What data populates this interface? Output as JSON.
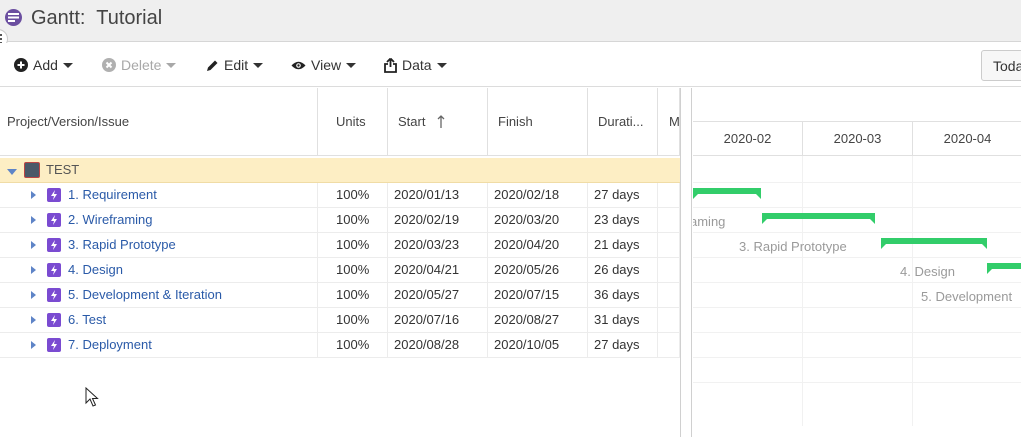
{
  "window": {
    "title": "Gantt:  Tutorial",
    "app_icon": "app-menu-icon"
  },
  "toolbar": {
    "add_label": "Add",
    "delete_label": "Delete",
    "edit_label": "Edit",
    "view_label": "View",
    "data_label": "Data",
    "today_label": "Toda"
  },
  "columns": {
    "name": "Project/Version/Issue",
    "units": "Units",
    "start": "Start",
    "finish": "Finish",
    "duration": "Durati...",
    "more": "M"
  },
  "project": {
    "name": "TEST"
  },
  "issues": [
    {
      "name": "1. Requirement",
      "units": "100%",
      "start": "2020/01/13",
      "finish": "2020/02/18",
      "duration": "27 days"
    },
    {
      "name": "2. Wireframing",
      "units": "100%",
      "start": "2020/02/19",
      "finish": "2020/03/20",
      "duration": "23 days"
    },
    {
      "name": "3. Rapid Prototype",
      "units": "100%",
      "start": "2020/03/23",
      "finish": "2020/04/20",
      "duration": "21 days"
    },
    {
      "name": "4. Design",
      "units": "100%",
      "start": "2020/04/21",
      "finish": "2020/05/26",
      "duration": "26 days"
    },
    {
      "name": "5. Development & Iteration",
      "units": "100%",
      "start": "2020/05/27",
      "finish": "2020/07/15",
      "duration": "36 days"
    },
    {
      "name": "6. Test",
      "units": "100%",
      "start": "2020/07/16",
      "finish": "2020/08/27",
      "duration": "31 days"
    },
    {
      "name": "7. Deployment",
      "units": "100%",
      "start": "2020/08/28",
      "finish": "2020/10/05",
      "duration": "27 days"
    }
  ],
  "timeline": {
    "months": [
      "2020-02",
      "2020-03",
      "2020-04"
    ],
    "bar_labels": [
      "aming",
      "3. Rapid Prototype",
      "4. Design",
      "5. Development"
    ]
  },
  "colors": {
    "bar": "#32cd6a",
    "project_row": "#fdeec4",
    "issue_icon": "#7a4bd1",
    "link": "#2a5aa8"
  }
}
